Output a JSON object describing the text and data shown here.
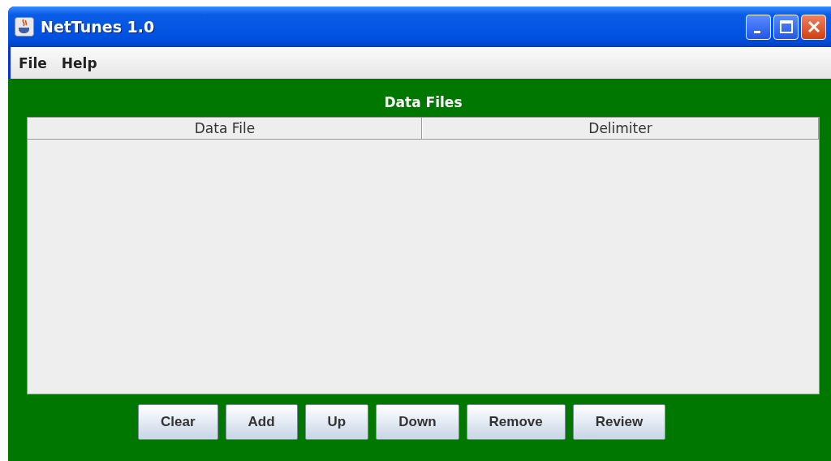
{
  "window": {
    "title": "NetTunes 1.0"
  },
  "menu": [
    "File",
    "Help"
  ],
  "panel": {
    "title": "Data Files"
  },
  "table": {
    "columns": [
      "Data File",
      "Delimiter"
    ]
  },
  "buttons": [
    "Clear",
    "Add",
    "Up",
    "Down",
    "Remove",
    "Review"
  ]
}
